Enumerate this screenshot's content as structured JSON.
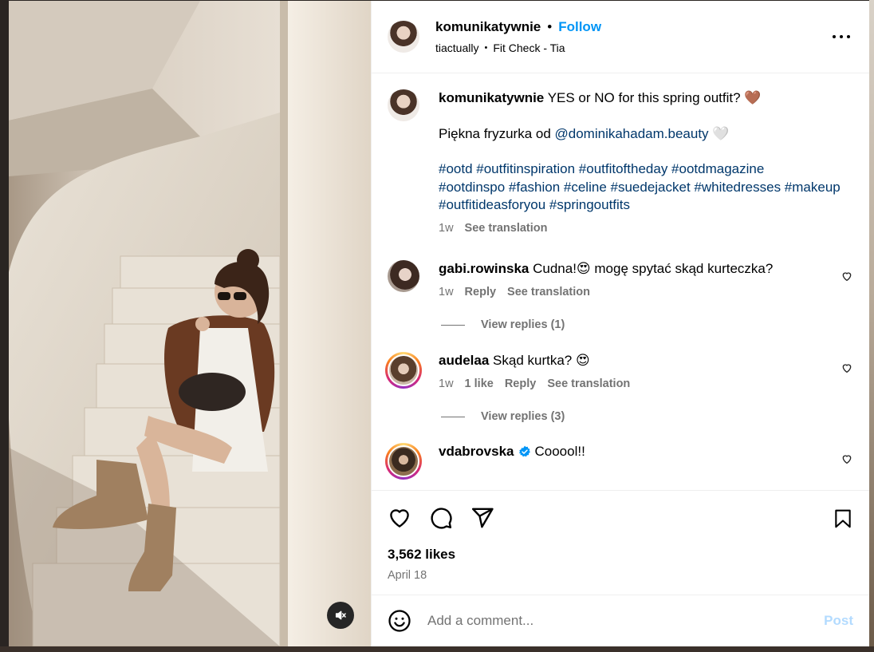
{
  "post": {
    "author": "komunikatywnie",
    "follow_label": "Follow",
    "audio_user": "tiactually",
    "audio_track": "Fit Check - Tia",
    "more_icon": "more-horizontal-icon",
    "mute_icon": "speaker-muted-icon"
  },
  "caption": {
    "username": "komunikatywnie",
    "text": "YES or NO for this spring outfit? 🤎",
    "line2_prefix": "Piękna fryzurka od ",
    "mention": "@dominikahadam.beauty",
    "line2_suffix": " 🤍",
    "hashtags_line1": "#ootd #outfitinspiration #outfitoftheday #ootdmagazine",
    "hashtags_line2": "#ootdinspo #fashion #celine #suedejacket #whitedresses #makeup",
    "hashtags_line3": "#outfitideasforyou #springoutfits",
    "time": "1w",
    "translate": "See translation"
  },
  "comments": [
    {
      "username": "gabi.rowinska",
      "text": "Cudna!😍 mogę spytać skąd kurteczka?",
      "time": "1w",
      "likes": "",
      "reply": "Reply",
      "translate": "See translation",
      "view_replies": "View replies (1)"
    },
    {
      "username": "audelaa",
      "text": "Skąd kurtka? 😍",
      "time": "1w",
      "likes": "1 like",
      "reply": "Reply",
      "translate": "See translation",
      "view_replies": "View replies (3)"
    },
    {
      "username": "vdabrovska",
      "text": "Cooool!!",
      "verified": true
    }
  ],
  "actions": {
    "like_icon": "heart-icon",
    "comment_icon": "comment-icon",
    "share_icon": "share-icon",
    "save_icon": "bookmark-icon",
    "likes": "3,562 likes",
    "date": "April 18"
  },
  "add_comment": {
    "emoji_icon": "emoji-icon",
    "placeholder": "Add a comment...",
    "post_label": "Post"
  },
  "colors": {
    "link_blue": "#00376b",
    "follow_blue": "#0095f6",
    "post_disabled": "#b3dbff",
    "secondary_text": "#737373"
  }
}
